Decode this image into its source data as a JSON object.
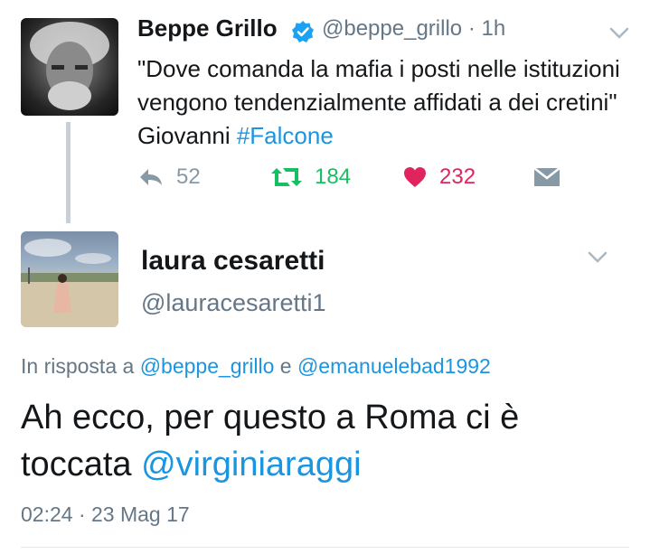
{
  "tweet": {
    "author_name": "Beppe Grillo",
    "author_handle": "@beppe_grillo",
    "time_ago": "1h",
    "text_before": "\"Dove comanda la mafia i posti nelle istituzioni vengono tendenzialmente affidati a dei cretini\" Giovanni ",
    "hashtag": "#Falcone",
    "reply_count": "52",
    "retweet_count": "184",
    "like_count": "232",
    "verified": true
  },
  "reply": {
    "author_name": "laura cesaretti",
    "author_handle": "@lauracesaretti1",
    "in_reply_prefix": "In risposta a",
    "in_reply_mention_1": "@beppe_grillo",
    "in_reply_conjunction": "e",
    "in_reply_mention_2": "@emanuelebad1992",
    "text_before": "Ah ecco, per questo a Roma ci è toccata ",
    "mention": "@virginiaraggi",
    "timestamp": "02:24 · 23 Mag 17"
  },
  "icons": {
    "verified": "verified-badge-icon",
    "reply": "reply-arrow-icon",
    "retweet": "retweet-icon",
    "like": "heart-icon",
    "dm": "envelope-icon",
    "menu": "chevron-down-icon"
  },
  "colors": {
    "link": "#1b95e0",
    "retweet": "#17bf63",
    "like": "#e0245e",
    "muted": "#657786",
    "thread_line": "#c7d0d8"
  }
}
